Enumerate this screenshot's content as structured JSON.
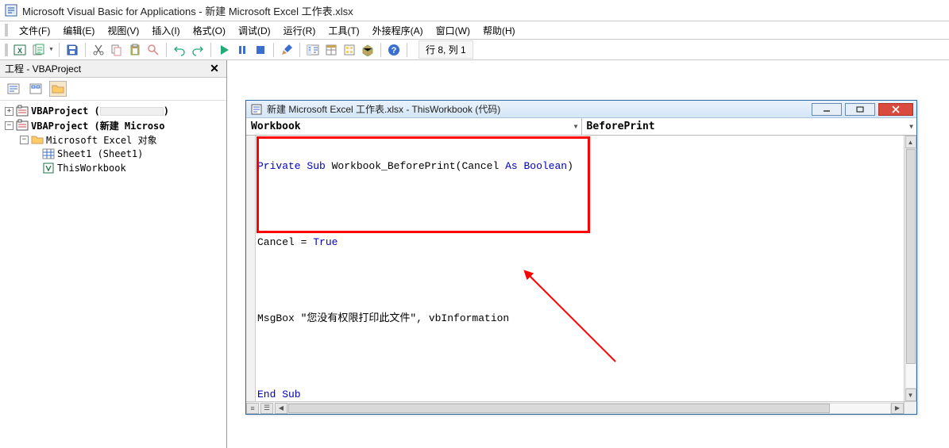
{
  "app": {
    "title": "Microsoft Visual Basic for Applications - 新建 Microsoft Excel 工作表.xlsx"
  },
  "menu": {
    "file": "文件(F)",
    "edit": "编辑(E)",
    "view": "视图(V)",
    "insert": "插入(I)",
    "format": "格式(O)",
    "debug": "调试(D)",
    "run": "运行(R)",
    "tools": "工具(T)",
    "addins": "外接程序(A)",
    "window": "窗口(W)",
    "help": "帮助(H)"
  },
  "status": {
    "position": "行 8, 列 1"
  },
  "project": {
    "pane_title": "工程 - VBAProject",
    "root1": "VBAProject (",
    "root1_tail": ")",
    "root2": "VBAProject (新建 Microso",
    "folder1": "Microsoft Excel 对象",
    "sheet1": "Sheet1 (Sheet1)",
    "thiswb": "ThisWorkbook"
  },
  "codewin": {
    "title": "新建 Microsoft Excel 工作表.xlsx - ThisWorkbook (代码)",
    "combo_object": "Workbook",
    "combo_proc": "BeforePrint"
  },
  "code": {
    "l1a": "Private Sub",
    "l1b": " Workbook_BeforePrint(Cancel ",
    "l1c": "As Boolean",
    "l1d": ")",
    "l2a": "Cancel = ",
    "l2b": "True",
    "l3a": "MsgBox \"您没有权限打印此文件\", vbInformation",
    "l4a": "End Sub"
  }
}
